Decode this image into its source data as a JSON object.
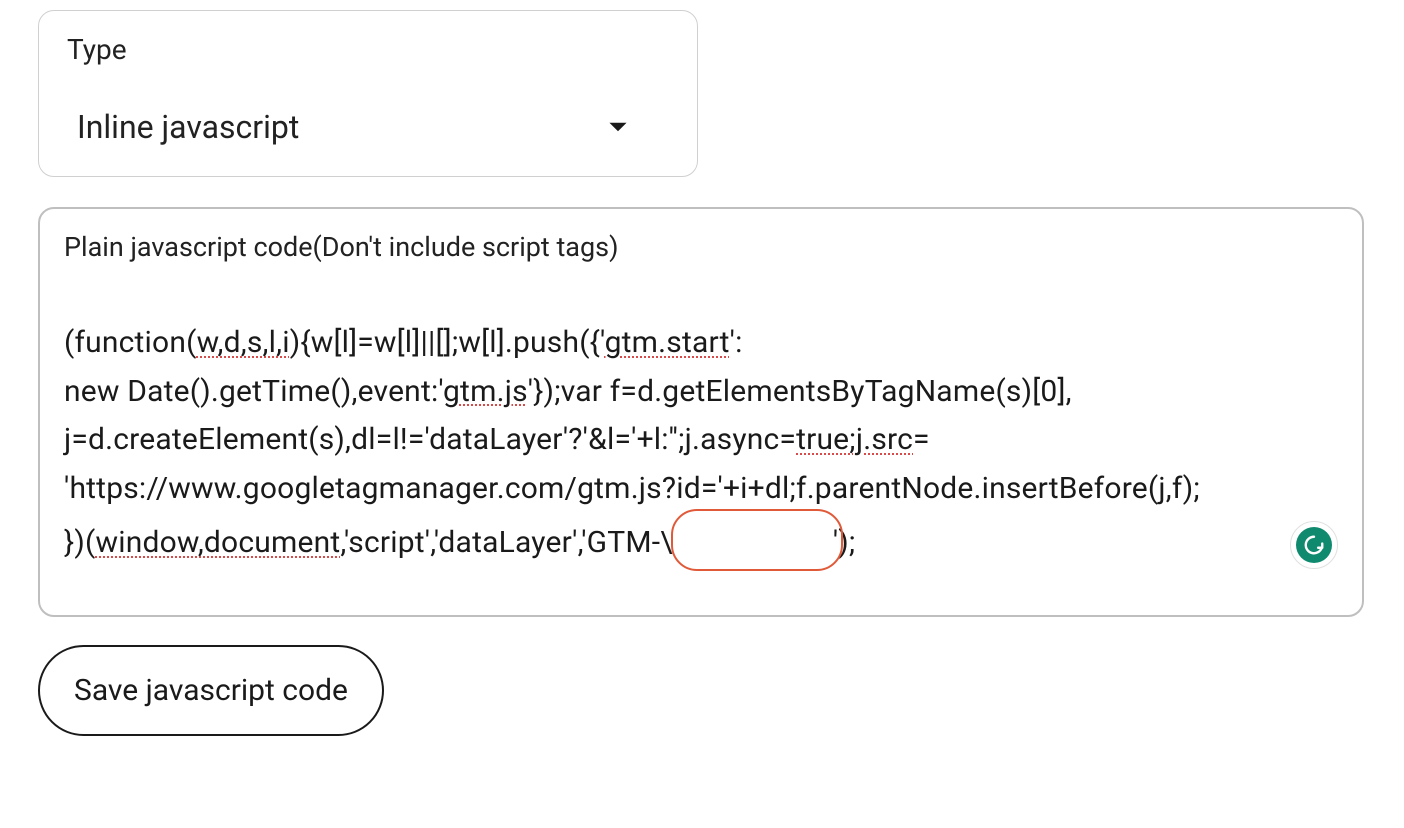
{
  "type_field": {
    "label": "Type",
    "selected_value": "Inline javascript"
  },
  "code_field": {
    "label": "Plain javascript code(Don't include script tags)",
    "code_parts": {
      "p1": "(function(",
      "p2": "w,d,s,l,i",
      "p3": "){w[l]=w[l]||[];w[l].push({'",
      "p4": "gtm.start",
      "p5": "':\nnew Date().getTime(),event:'",
      "p6": "gtm.js",
      "p7": "'});var f=d.getElementsByTagName(s)[0],\nj=d.createElement(s),dl=l!='dataLayer'?'&l='+l:'';j.async=",
      "p8": "true;j.src",
      "p9": "=\n'https://www.googletagmanager.com/gtm.js?id='+i+dl;f.parentNode.insertBefore(j,f);\n})(",
      "p10": "window,document",
      "p11": ",'script','dataLayer','GTM-\\",
      "p12": "');"
    }
  },
  "save_button": {
    "label": "Save javascript code"
  }
}
